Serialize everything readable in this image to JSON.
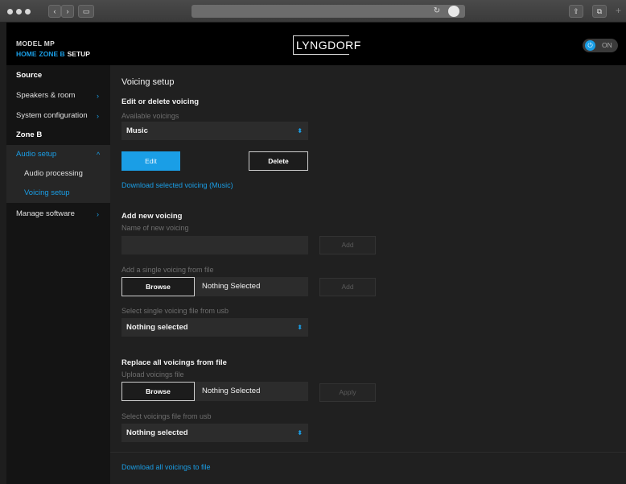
{
  "chrome": {
    "back_glyph": "‹",
    "forward_glyph": "›",
    "sidebar_glyph": "▭",
    "reload_glyph": "↻",
    "share_glyph": "⇪",
    "tabs_glyph": "⧉",
    "new_tab_glyph": "+"
  },
  "header": {
    "model": "MODEL MP",
    "breadcrumb": [
      "HOME",
      "ZONE B",
      "SETUP"
    ],
    "logo": "LYNGDORF",
    "power_label": "ON",
    "power_glyph": "⏻"
  },
  "sidebar": {
    "source": "Source",
    "speakers": "Speakers & room",
    "system_configuration": "System configuration",
    "zone_b": "Zone B",
    "audio_setup": "Audio setup",
    "audio_processing": "Audio processing",
    "voicing_setup": "Voicing setup",
    "manage_software": "Manage software",
    "chevron_right": "›",
    "chevron_up": "^"
  },
  "main": {
    "title": "Voicing setup",
    "edit_section": {
      "heading": "Edit or delete voicing",
      "available_label": "Available voicings",
      "selected_voicing": "Music",
      "edit_button": "Edit",
      "delete_button": "Delete",
      "download_selected_link": "Download selected voicing (Music)"
    },
    "add_section": {
      "heading": "Add new voicing",
      "name_label": "Name of new voicing",
      "name_value": "",
      "add_button": "Add",
      "single_file_label": "Add a single voicing from file",
      "browse_button": "Browse",
      "single_file_name": "Nothing Selected",
      "single_file_add_button": "Add",
      "usb_label": "Select single voicing file from usb",
      "usb_value": "Nothing selected"
    },
    "replace_section": {
      "heading": "Replace all voicings from file",
      "upload_label": "Upload voicings file",
      "browse_button": "Browse",
      "file_name": "Nothing Selected",
      "apply_button": "Apply",
      "usb_label": "Select voicings file from usb",
      "usb_value": "Nothing selected"
    },
    "download_all_link": "Download all voicings to file",
    "select_arrow": "⬍"
  }
}
